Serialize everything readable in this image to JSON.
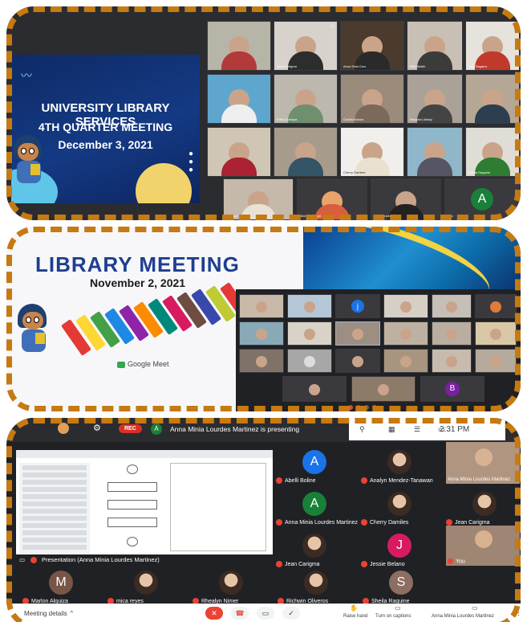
{
  "panel1": {
    "slide": {
      "line1": "UNIVERSITY LIBRARY SERVICES",
      "line2": "4TH QUARTER MEETING",
      "line3": "December 3, 2021"
    },
    "participants": [
      "Jean Carigma",
      "Anna Dela Cruz",
      "Ralf Martin",
      "Tina Sagarra",
      "Edith Gueluya",
      "Cecilia Buizon",
      "Marjoria Library",
      "Rhyna Villamor",
      "Edith Dalmay",
      "Cherry Damiles",
      "Shiela Raguine",
      "Rhealyn Nimer",
      "Michael Vergel",
      "Edith Gueluya",
      "Yoo"
    ],
    "avatar_letter": "A"
  },
  "panel2": {
    "title": "LIBRARY MEETING",
    "date": "November 2, 2021",
    "brand": "Google Meet",
    "avatar_letter_j": "j",
    "avatar_letter_b": "B"
  },
  "panel3": {
    "rec": "REC",
    "presenter_initial": "A",
    "presenting": "Anna Minia Lourdes Martinez is presenting",
    "time": "2:31 PM",
    "you_label": "You",
    "presentation_label": "Presentation (Anna Minia Lourdes Martinez)",
    "participants": [
      {
        "name": "Abelli Boline",
        "letter": "A",
        "color": "#1a73e8"
      },
      {
        "name": "Analyn Mendez-Tanawan"
      },
      {
        "name": "Anna Minia Lourdes Martinez",
        "featured": true
      },
      {
        "name": "Anna Minia Lourdes Martinez",
        "letter": "A",
        "color": "#188038"
      },
      {
        "name": "Cherry Damiles"
      },
      {
        "name": "Jean Carigma"
      },
      {
        "name": "Jean Carigma"
      },
      {
        "name": "Jessie Belano",
        "letter": "J",
        "color": "#d81b60"
      },
      {
        "name": "You"
      },
      {
        "name": "Marlon Alquiza",
        "letter": "M",
        "color": "#795548"
      },
      {
        "name": "mica reyes"
      },
      {
        "name": "Rhealyn Nimer"
      },
      {
        "name": "Richwin Oliveros"
      },
      {
        "name": "Sheila Raguine",
        "letter": "S",
        "color": "#8d6e63"
      }
    ],
    "bottom": {
      "meeting_details": "Meeting details",
      "raise_hand": "Raise hand",
      "captions": "Turn on captions",
      "presenter": "Anna Minia Lourdes Martinez"
    }
  },
  "colors": {
    "dash": "#c57a12",
    "meet_bg": "#202124",
    "rec": "#d93025"
  }
}
